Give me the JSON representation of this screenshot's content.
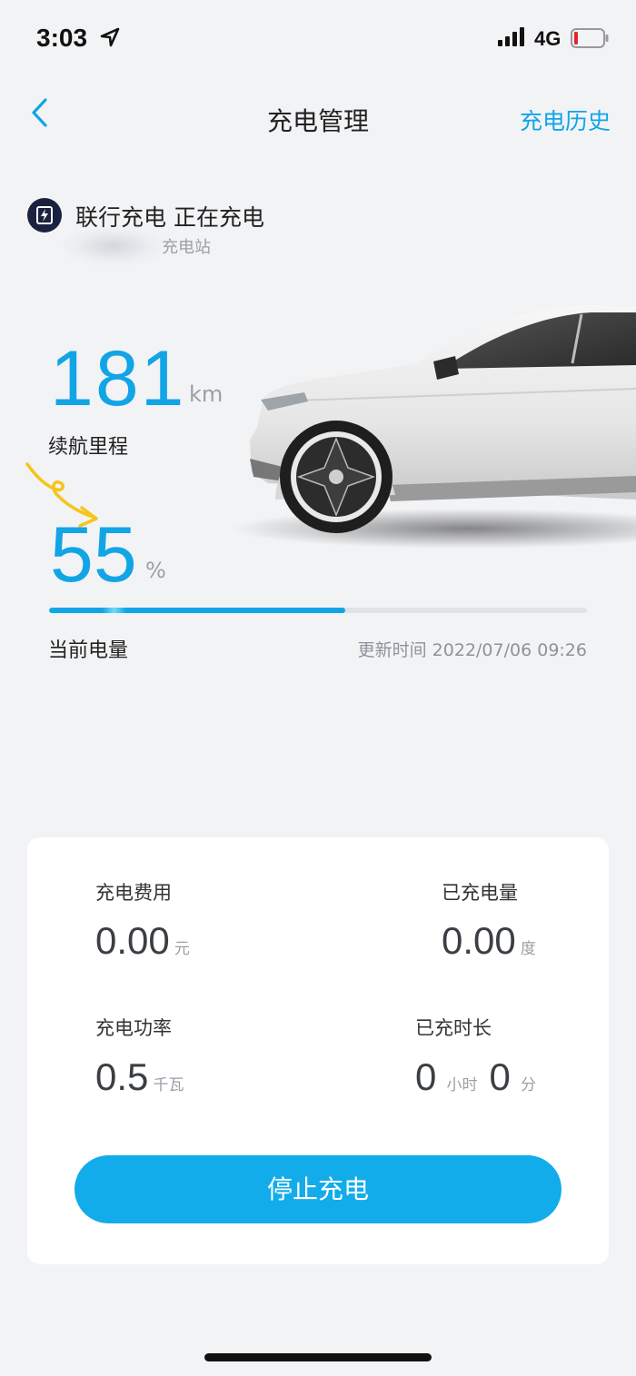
{
  "status_bar": {
    "time": "3:03",
    "network": "4G",
    "icons": [
      "location-arrow-icon",
      "signal-icon",
      "battery-low-icon"
    ]
  },
  "header": {
    "title": "充电管理",
    "history_link": "充电历史",
    "back_icon": "chevron-left-icon"
  },
  "station": {
    "icon": "charging-station-icon",
    "name": "联行充电 正在充电",
    "address": "充电站"
  },
  "range": {
    "value": "181",
    "unit": "km",
    "label": "续航里程"
  },
  "battery": {
    "value": "55",
    "unit": "%",
    "percent": 55,
    "label": "当前电量",
    "updated": "更新时间 2022/07/06 09:26"
  },
  "stats": {
    "fee": {
      "label": "充电费用",
      "value": "0.00",
      "unit": "元"
    },
    "energy": {
      "label": "已充电量",
      "value": "0.00",
      "unit": "度"
    },
    "power": {
      "label": "充电功率",
      "value": "0.5",
      "unit": "千瓦"
    },
    "duration": {
      "label": "已充时长",
      "hours": "0",
      "hours_unit": "小时",
      "minutes": "0",
      "minutes_unit": "分"
    }
  },
  "actions": {
    "stop_label": "停止充电"
  },
  "colors": {
    "accent": "#12a5e6",
    "button": "#12acea",
    "background": "#f2f3f5"
  }
}
